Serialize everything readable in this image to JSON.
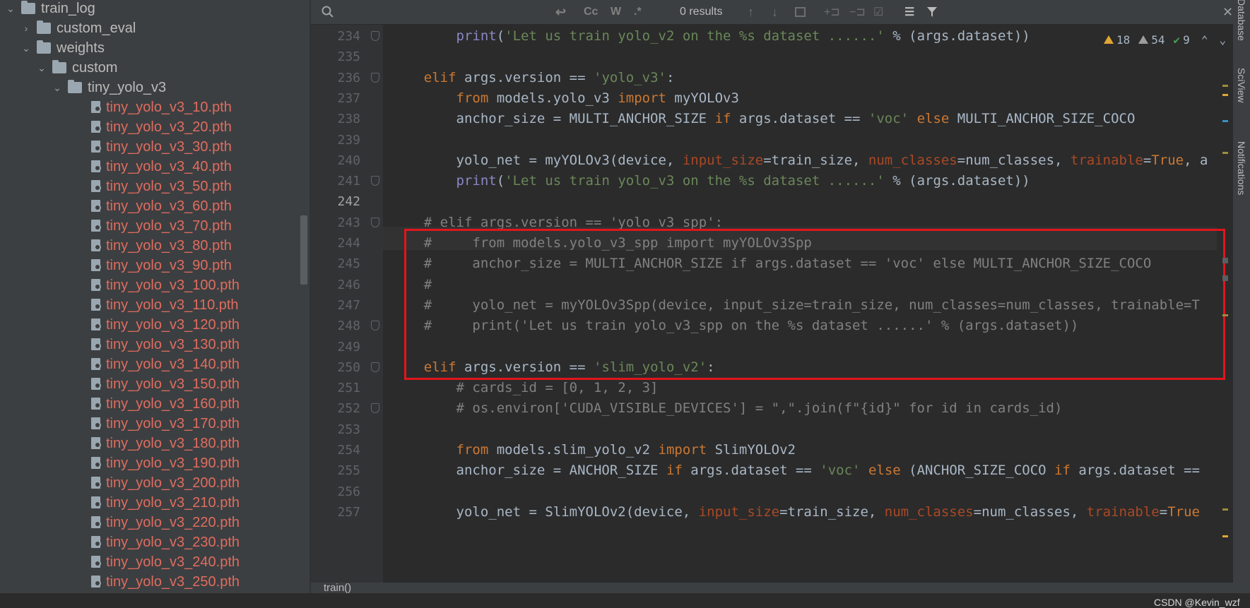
{
  "tree": {
    "items": [
      {
        "label": "train_log",
        "type": "folder",
        "expanded": true
      },
      {
        "label": "custom_eval",
        "type": "folder",
        "expanded": false
      },
      {
        "label": "weights",
        "type": "folder",
        "expanded": true
      },
      {
        "label": "custom",
        "type": "folder",
        "expanded": true
      },
      {
        "label": "tiny_yolo_v3",
        "type": "folder",
        "expanded": true
      }
    ],
    "files": [
      "tiny_yolo_v3_10.pth",
      "tiny_yolo_v3_20.pth",
      "tiny_yolo_v3_30.pth",
      "tiny_yolo_v3_40.pth",
      "tiny_yolo_v3_50.pth",
      "tiny_yolo_v3_60.pth",
      "tiny_yolo_v3_70.pth",
      "tiny_yolo_v3_80.pth",
      "tiny_yolo_v3_90.pth",
      "tiny_yolo_v3_100.pth",
      "tiny_yolo_v3_110.pth",
      "tiny_yolo_v3_120.pth",
      "tiny_yolo_v3_130.pth",
      "tiny_yolo_v3_140.pth",
      "tiny_yolo_v3_150.pth",
      "tiny_yolo_v3_160.pth",
      "tiny_yolo_v3_170.pth",
      "tiny_yolo_v3_180.pth",
      "tiny_yolo_v3_190.pth",
      "tiny_yolo_v3_200.pth",
      "tiny_yolo_v3_210.pth",
      "tiny_yolo_v3_220.pth",
      "tiny_yolo_v3_230.pth",
      "tiny_yolo_v3_240.pth",
      "tiny_yolo_v3_250.pth"
    ]
  },
  "findbar": {
    "results": "0 results",
    "match_case": "Cc",
    "words": "W",
    "regex": ".*"
  },
  "inspections": {
    "errors": "18",
    "warnings": "54",
    "ok": "9"
  },
  "editor": {
    "current_line": "242",
    "breadcrumb": "train()",
    "lines": [
      {
        "num": "234",
        "text": "        print('Let us train yolo_v2 on the %s dataset ......' % (args.dataset))"
      },
      {
        "num": "235",
        "text": ""
      },
      {
        "num": "236",
        "text": "    elif args.version == 'yolo_v3':"
      },
      {
        "num": "237",
        "text": "        from models.yolo_v3 import myYOLOv3"
      },
      {
        "num": "238",
        "text": "        anchor_size = MULTI_ANCHOR_SIZE if args.dataset == 'voc' else MULTI_ANCHOR_SIZE_COCO"
      },
      {
        "num": "239",
        "text": ""
      },
      {
        "num": "240",
        "text": "        yolo_net = myYOLOv3(device, input_size=train_size, num_classes=num_classes, trainable=True, a"
      },
      {
        "num": "241",
        "text": "        print('Let us train yolo_v3 on the %s dataset ......' % (args.dataset))"
      },
      {
        "num": "242",
        "text": ""
      },
      {
        "num": "243",
        "text": "    # elif args.version == 'yolo_v3_spp':"
      },
      {
        "num": "244",
        "text": "    #     from models.yolo_v3_spp import myYOLOv3Spp"
      },
      {
        "num": "245",
        "text": "    #     anchor_size = MULTI_ANCHOR_SIZE if args.dataset == 'voc' else MULTI_ANCHOR_SIZE_COCO"
      },
      {
        "num": "246",
        "text": "    #"
      },
      {
        "num": "247",
        "text": "    #     yolo_net = myYOLOv3Spp(device, input_size=train_size, num_classes=num_classes, trainable=T"
      },
      {
        "num": "248",
        "text": "    #     print('Let us train yolo_v3_spp on the %s dataset ......' % (args.dataset))"
      },
      {
        "num": "249",
        "text": ""
      },
      {
        "num": "250",
        "text": "    elif args.version == 'slim_yolo_v2':"
      },
      {
        "num": "251",
        "text": "        # cards_id = [0, 1, 2, 3]"
      },
      {
        "num": "252",
        "text": "        # os.environ['CUDA_VISIBLE_DEVICES'] = \",\".join(f\"{id}\" for id in cards_id)"
      },
      {
        "num": "253",
        "text": ""
      },
      {
        "num": "254",
        "text": "        from models.slim_yolo_v2 import SlimYOLOv2"
      },
      {
        "num": "255",
        "text": "        anchor_size = ANCHOR_SIZE if args.dataset == 'voc' else (ANCHOR_SIZE_COCO if args.dataset =="
      },
      {
        "num": "256",
        "text": ""
      },
      {
        "num": "257",
        "text": "        yolo_net = SlimYOLOv2(device, input_size=train_size, num_classes=num_classes, trainable=True"
      }
    ]
  },
  "right_tools": [
    "Database",
    "SciView",
    "Notifications"
  ],
  "watermark": "CSDN @Kevin_wzf",
  "colors": {
    "highlight_box": "#e3151c",
    "file_vcs": "#e06c5f",
    "keyword": "#cc7832",
    "string": "#6a8759"
  }
}
